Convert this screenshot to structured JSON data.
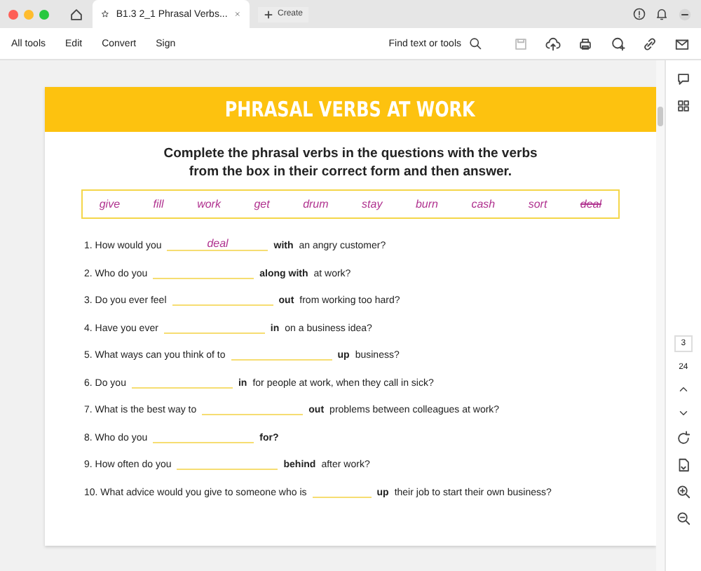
{
  "tab_bar": {
    "tab_title": "B1.3 2_1 Phrasal Verbs...",
    "create_label": "Create"
  },
  "toolbar": {
    "menu": [
      "All tools",
      "Edit",
      "Convert",
      "Sign"
    ],
    "find_label": "Find text or tools"
  },
  "document": {
    "title": "PHRASAL VERBS AT WORK",
    "instructions": "Complete the phrasal verbs in the questions with the verbs from the box in their correct form and then answer.",
    "word_box": [
      {
        "word": "give",
        "used": false
      },
      {
        "word": "fill",
        "used": false
      },
      {
        "word": "work",
        "used": false
      },
      {
        "word": "get",
        "used": false
      },
      {
        "word": "drum",
        "used": false
      },
      {
        "word": "stay",
        "used": false
      },
      {
        "word": "burn",
        "used": false
      },
      {
        "word": "cash",
        "used": false
      },
      {
        "word": "sort",
        "used": false
      },
      {
        "word": "deal",
        "used": true
      }
    ],
    "questions": [
      {
        "before": "1. How would you",
        "kind": "long",
        "answer": "deal",
        "particle": "with",
        "after": "an angry customer?"
      },
      {
        "before": "2. Who do you",
        "kind": "long",
        "particle": "along with",
        "after": "at work?"
      },
      {
        "before": "3. Do you ever feel",
        "kind": "long",
        "particle": "out",
        "after": "from working too hard?"
      },
      {
        "before": "4. Have you ever",
        "kind": "long",
        "particle": "in",
        "after": "on a business idea?"
      },
      {
        "before": "5. What ways can you think of to",
        "kind": "long",
        "particle": "up",
        "after": "business?"
      },
      {
        "before": "6. Do you",
        "kind": "long",
        "particle": "in",
        "after": "for people at work, when they call in sick?"
      },
      {
        "before": "7. What is the best way to",
        "kind": "long",
        "particle": "out",
        "after": "problems between colleagues at work?"
      },
      {
        "before": "8. Who do you",
        "kind": "long",
        "particle": "for?"
      },
      {
        "before": "9. How often do you",
        "kind": "long",
        "particle": "behind",
        "after": "after work?"
      },
      {
        "before": "10. What advice would you give to someone who is",
        "kind": "short",
        "particle": "up",
        "after": "their job to start their own business?"
      }
    ]
  },
  "page_nav": {
    "current": "3",
    "total": "24"
  }
}
